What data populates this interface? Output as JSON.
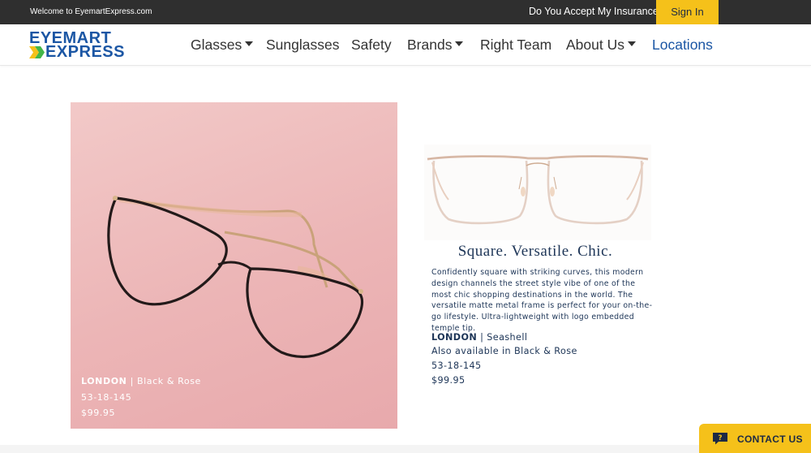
{
  "topbar": {
    "welcome": "Welcome to EyemartExpress.com",
    "insurance_link": "Do You Accept My Insurance?",
    "sign_in": "Sign In"
  },
  "brand": {
    "line1": "EYEMART",
    "line2": "EXPRESS"
  },
  "nav": {
    "items": [
      {
        "label": "Glasses",
        "dropdown": true
      },
      {
        "label": "Sunglasses",
        "dropdown": false
      },
      {
        "label": "Safety",
        "dropdown": false
      },
      {
        "label": "Brands",
        "dropdown": true
      },
      {
        "label": "Right Team",
        "dropdown": false
      },
      {
        "label": "About Us",
        "dropdown": true
      },
      {
        "label": "Locations",
        "dropdown": false
      }
    ]
  },
  "hero": {
    "model": "LONDON",
    "separator": "|",
    "color": "Black & Rose",
    "size": "53-18-145",
    "price": "$99.95"
  },
  "product": {
    "tagline": "Square. Versatile. Chic.",
    "description": "Confidently square with striking curves, this modern design channels the street style vibe of one of the most chic shopping destinations in the world. The versatile matte metal frame is perfect for your on-the-go lifestyle. Ultra-lightweight with logo embedded temple tip.",
    "model": "LONDON",
    "separator": "|",
    "color": "Seashell",
    "also_available": "Also available in Black & Rose",
    "size": "53-18-145",
    "price": "$99.95"
  },
  "contact": {
    "label": "CONTACT US"
  },
  "colors": {
    "topbar_bg": "#2f2f2f",
    "accent_yellow": "#f5c11a",
    "brand_blue": "#1b56a4",
    "navy_text": "#1d3557",
    "hero_pink": "#ecb5b6"
  },
  "icons": {
    "nav_caret": "caret-down-icon",
    "contact": "chat-bubble-icon"
  }
}
